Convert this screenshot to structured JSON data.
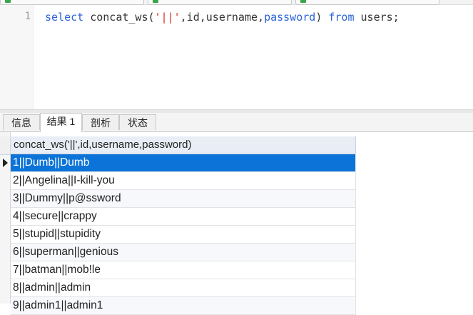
{
  "editor": {
    "line_number": "1",
    "tokens": {
      "select": "select",
      "func_open": "concat_ws(",
      "separator_str": "'||'",
      "args_a": ",id,username,",
      "password": "password",
      "close": ")",
      "from": "from",
      "table": "users;"
    }
  },
  "tabs": [
    {
      "label": "信息"
    },
    {
      "label": "结果 1"
    },
    {
      "label": "剖析"
    },
    {
      "label": "状态"
    }
  ],
  "grid": {
    "column_header": "concat_ws('||',id,username,password)",
    "rows": [
      "1||Dumb||Dumb",
      "2||Angelina||I-kill-you",
      "3||Dummy||p@ssword",
      "4||secure||crappy",
      "5||stupid||stupidity",
      "6||superman||genious",
      "7||batman||mob!le",
      "8||admin||admin",
      "9||admin1||admin1"
    ],
    "selected_row": 1
  },
  "colors": {
    "keyword": "#2b63d6",
    "string": "#d1342b",
    "selection": "#0c74d8"
  }
}
